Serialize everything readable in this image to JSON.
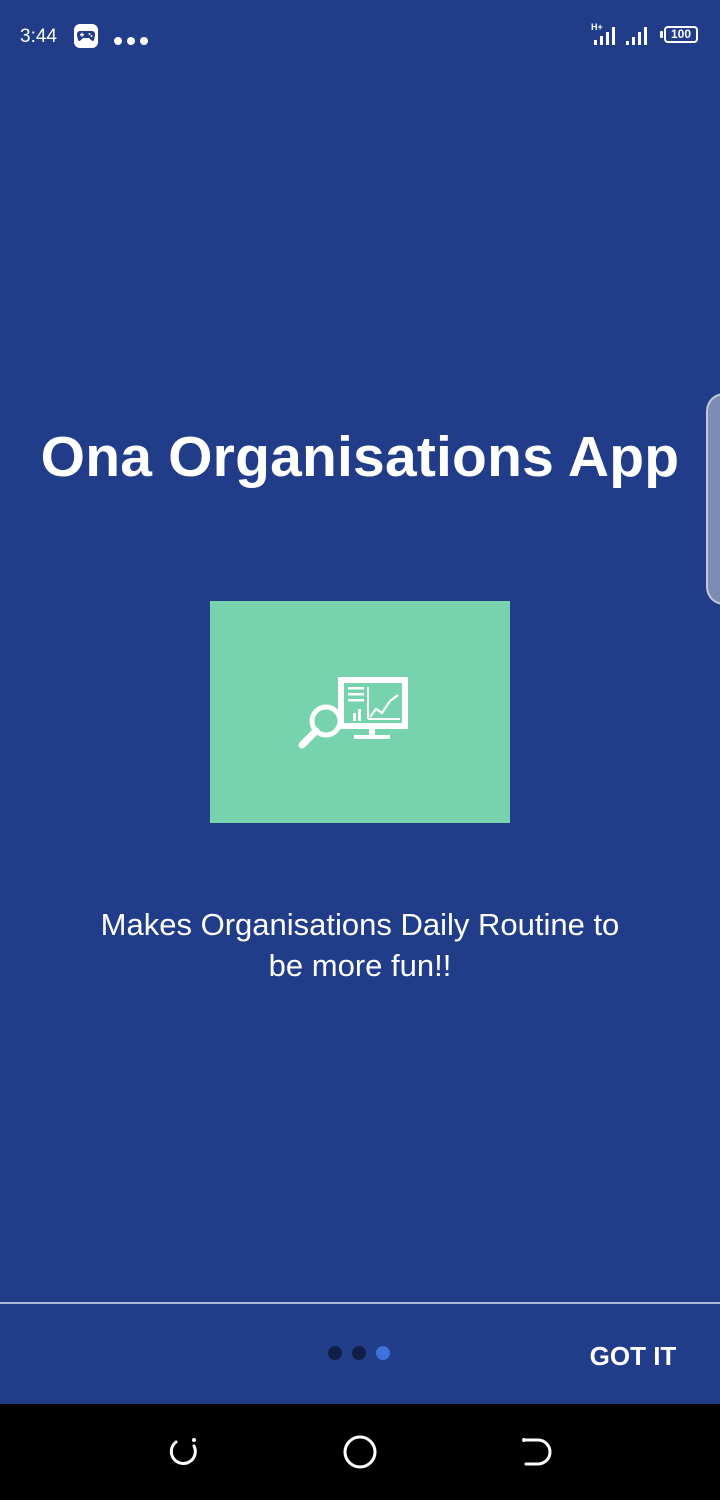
{
  "status_bar": {
    "time": "3:44",
    "network": "H+",
    "battery": "100",
    "icons": [
      "game-controller-icon",
      "more-dots-icon",
      "signal-sim1-icon",
      "signal-sim2-icon",
      "battery-icon"
    ]
  },
  "intro": {
    "title": "Ona Organisations App",
    "illustration": "analytics-magnifier-monitor-icon",
    "description": "Makes Organisations Daily Routine to be more fun!!"
  },
  "footer": {
    "done_label": "GOT IT",
    "page_count": 3,
    "current_page": 3
  },
  "nav_bar": {
    "buttons": [
      "recents-icon",
      "home-icon",
      "back-icon"
    ]
  },
  "colors": {
    "background": "#213d8a",
    "tile": "#77d3ae",
    "dot_inactive": "#0f1f48",
    "dot_active": "#3f6fd8"
  }
}
